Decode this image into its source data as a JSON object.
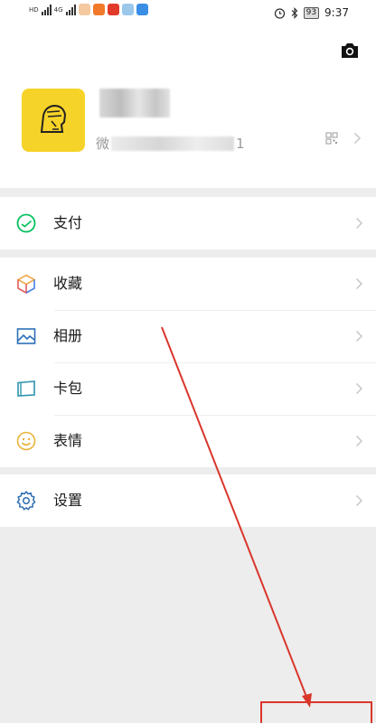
{
  "status_bar": {
    "left_tags": [
      "HD",
      "4G",
      "HD",
      "4G"
    ],
    "battery": "93",
    "time": "9:37"
  },
  "profile": {
    "wxid_prefix": "微",
    "wxid_suffix": "1"
  },
  "menu": {
    "pay": "支付",
    "favorites": "收藏",
    "album": "相册",
    "cards": "卡包",
    "stickers": "表情",
    "settings": "设置"
  },
  "colors": {
    "pay_icon": "#07c160",
    "avatar_bg": "#f6d328",
    "annotation": "#d9362b"
  }
}
